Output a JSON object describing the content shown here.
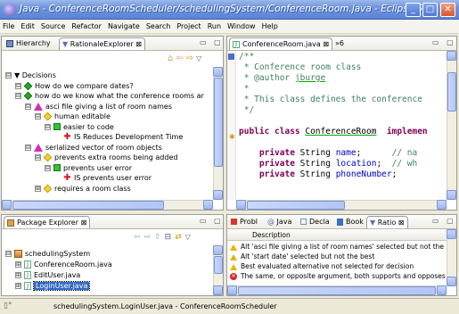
{
  "window": {
    "title": "Java - ConferenceRoomScheduler/schedulingSystem/ConferenceRoom.java - Eclipse SDK"
  },
  "menu": [
    "File",
    "Edit",
    "Source",
    "Refactor",
    "Navigate",
    "Search",
    "Project",
    "Run",
    "Window",
    "Help"
  ],
  "explorer": {
    "tabs": [
      {
        "label": "Hierarchy"
      },
      {
        "label": "RationaleExplorer",
        "close": "⊠"
      }
    ],
    "tree": [
      {
        "indent": 0,
        "toggle": "⊟",
        "icon": "none",
        "label": "▼ Decisions"
      },
      {
        "indent": 1,
        "toggle": "⊟",
        "icon": "diamond-green",
        "label": "How do we compare dates?"
      },
      {
        "indent": 1,
        "toggle": "⊟",
        "icon": "diamond-green",
        "label": "how do we know what the conference rooms ar"
      },
      {
        "indent": 2,
        "toggle": "⊟",
        "icon": "triangle-magenta",
        "label": "asci file giving a list of room names"
      },
      {
        "indent": 3,
        "toggle": "⊟",
        "icon": "diamond-yellow",
        "label": "human editable"
      },
      {
        "indent": 4,
        "toggle": "⊟",
        "icon": "square-green",
        "label": "easier to code"
      },
      {
        "indent": 5,
        "toggle": "",
        "icon": "cross-red",
        "label": "IS Reduces Development Time"
      },
      {
        "indent": 2,
        "toggle": "⊟",
        "icon": "triangle-magenta",
        "label": "serialized vector of room objects"
      },
      {
        "indent": 3,
        "toggle": "⊟",
        "icon": "diamond-yellow",
        "label": "prevents extra rooms being added"
      },
      {
        "indent": 4,
        "toggle": "⊟",
        "icon": "square-green",
        "label": "prevents user error"
      },
      {
        "indent": 5,
        "toggle": "",
        "icon": "cross-red",
        "label": "IS prevents user error"
      },
      {
        "indent": 3,
        "toggle": "⊞",
        "icon": "diamond-yellow",
        "label": "requires a room class"
      }
    ]
  },
  "package_explorer": {
    "tab": "Package Explorer",
    "close": "⊠",
    "tree": [
      {
        "indent": 0,
        "toggle": "⊟",
        "icon": "package",
        "label": "schedulingSystem",
        "selected": false
      },
      {
        "indent": 1,
        "toggle": "⊞",
        "icon": "java-file",
        "label": "ConferenceRoom.java",
        "selected": false
      },
      {
        "indent": 1,
        "toggle": "⊞",
        "icon": "java-file",
        "label": "EditUser.java",
        "selected": false
      },
      {
        "indent": 1,
        "toggle": "⊞",
        "icon": "java-file",
        "label": "LoginUser.java",
        "selected": true
      }
    ]
  },
  "editor": {
    "tab": "ConferenceRoom.java",
    "close": "⊠",
    "overflow": "»6",
    "lines": [
      {
        "parts": [
          {
            "t": "/**",
            "c": "cmt"
          }
        ]
      },
      {
        "parts": [
          {
            "t": " * Conference room class",
            "c": "cmt"
          }
        ]
      },
      {
        "parts": [
          {
            "t": " * @author ",
            "c": "cmt"
          },
          {
            "t": "jburge",
            "c": "cmt ul"
          }
        ]
      },
      {
        "parts": [
          {
            "t": " *",
            "c": "cmt"
          }
        ]
      },
      {
        "parts": [
          {
            "t": " * This class defines the conference",
            "c": "cmt"
          }
        ]
      },
      {
        "parts": [
          {
            "t": " */",
            "c": "cmt"
          }
        ]
      },
      {
        "parts": [
          {
            "t": "",
            "c": ""
          }
        ]
      },
      {
        "parts": [
          {
            "t": "public class ",
            "c": "kw"
          },
          {
            "t": "ConferenceRoom",
            "c": "ul"
          },
          {
            "t": "  implemen",
            "c": "kw"
          }
        ]
      },
      {
        "parts": [
          {
            "t": "",
            "c": ""
          }
        ]
      },
      {
        "parts": [
          {
            "t": "    private ",
            "c": "kw"
          },
          {
            "t": "String ",
            "c": ""
          },
          {
            "t": "name",
            "c": "fld"
          },
          {
            "t": ";      ",
            "c": ""
          },
          {
            "t": "// na",
            "c": "cmt"
          }
        ]
      },
      {
        "parts": [
          {
            "t": "    private ",
            "c": "kw"
          },
          {
            "t": "String ",
            "c": ""
          },
          {
            "t": "location",
            "c": "fld"
          },
          {
            "t": ";  ",
            "c": ""
          },
          {
            "t": "// wh",
            "c": "cmt"
          }
        ]
      },
      {
        "parts": [
          {
            "t": "    private ",
            "c": "kw"
          },
          {
            "t": "String ",
            "c": ""
          },
          {
            "t": "phoneNumber",
            "c": "fld"
          },
          {
            "t": ";",
            "c": ""
          }
        ]
      }
    ]
  },
  "problems": {
    "tabs": [
      {
        "label": "Probl"
      },
      {
        "label": "Java"
      },
      {
        "label": "Decla"
      },
      {
        "label": "Book"
      },
      {
        "label": "Ratio",
        "close": "⊠"
      }
    ],
    "header": "Description",
    "rows": [
      {
        "type": "warning",
        "text": "Alt 'asci file giving a list of room names' selected but not the best"
      },
      {
        "type": "warning",
        "text": "Alt 'start date' selected but not the best"
      },
      {
        "type": "warning",
        "text": "Best evaluated alternative not selected for decision"
      },
      {
        "type": "error",
        "text": "The same, or opposite argument, both supports and  opposes alte"
      }
    ]
  },
  "status": {
    "text": "schedulingSystem.LoginUser.java - ConferenceRoomScheduler"
  }
}
